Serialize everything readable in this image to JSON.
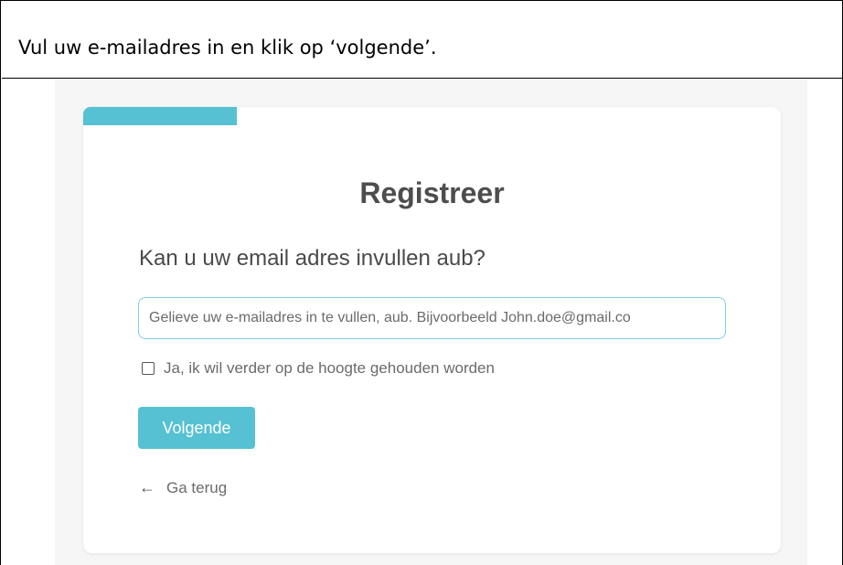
{
  "instruction": {
    "text": "Vul uw e-mailadres in en klik op ‘volgende’."
  },
  "progress": {
    "fraction": 0.22,
    "color": "#55c1d2"
  },
  "form": {
    "title": "Registreer",
    "question": "Kan u uw email adres invullen aub?",
    "email_placeholder": "Gelieve uw e-mailadres in te vullen, aub. Bijvoorbeeld John.doe@gmail.co",
    "email_value": "",
    "newsletter_label": "Ja, ik wil verder op de hoogte gehouden worden",
    "newsletter_checked": false,
    "next_label": "Volgende",
    "back_label": "Ga terug",
    "back_icon": "arrow-left-icon"
  }
}
